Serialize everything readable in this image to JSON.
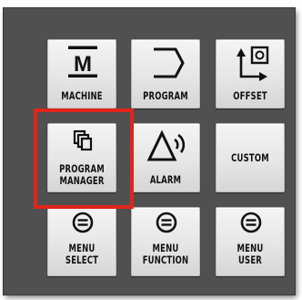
{
  "keys": {
    "machine": {
      "label": "MACHINE",
      "icon_text": "M"
    },
    "program": {
      "label": "PROGRAM"
    },
    "offset": {
      "label": "OFFSET"
    },
    "program_manager": {
      "label_line1": "PROGRAM",
      "label_line2": "MANAGER"
    },
    "alarm": {
      "label": "ALARM"
    },
    "custom": {
      "label": "CUSTOM"
    },
    "menu_select": {
      "label_line1": "MENU",
      "label_line2": "SELECT"
    },
    "menu_function": {
      "label_line1": "MENU",
      "label_line2": "FUNCTION"
    },
    "menu_user": {
      "label_line1": "MENU",
      "label_line2": "USER"
    }
  },
  "highlight": {
    "target": "program_manager",
    "color": "#e0251c"
  },
  "icons": [
    "machine-icon",
    "program-icon",
    "offset-icon",
    "program-manager-icon",
    "alarm-icon",
    "menu-icon"
  ],
  "colors": {
    "panel": "#505050",
    "key": "#e9e9e9",
    "text": "#111111"
  }
}
